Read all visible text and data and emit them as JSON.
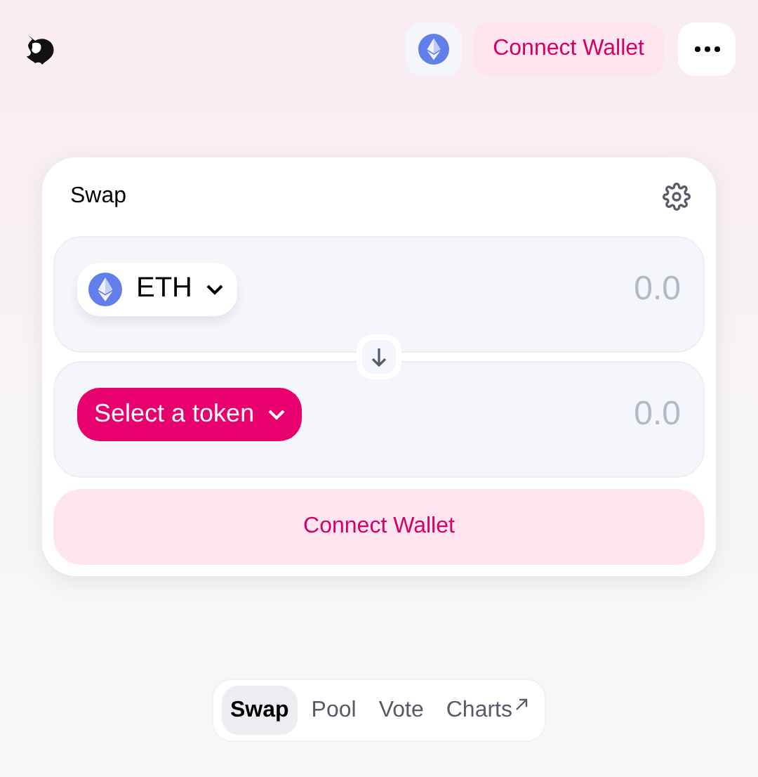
{
  "header": {
    "connect_button": "Connect Wallet"
  },
  "swap": {
    "title": "Swap",
    "inputs": [
      {
        "kind": "token",
        "token": "ETH",
        "placeholder": "0.0"
      },
      {
        "kind": "select",
        "token": "Select a token",
        "placeholder": "0.0"
      }
    ],
    "action_button": "Connect Wallet"
  },
  "nav": [
    {
      "label": "Swap",
      "selected": true,
      "external": false
    },
    {
      "label": "Pool",
      "selected": false,
      "external": false
    },
    {
      "label": "Vote",
      "selected": false,
      "external": false
    },
    {
      "label": "Charts",
      "selected": false,
      "external": true
    }
  ]
}
